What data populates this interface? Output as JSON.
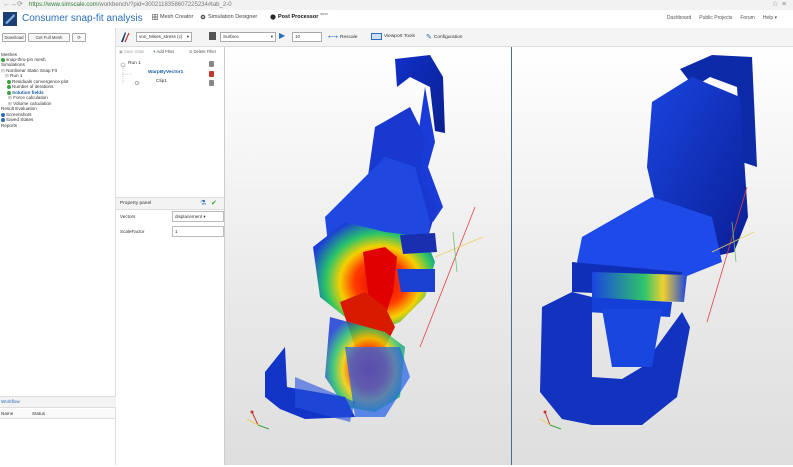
{
  "browser": {
    "url_domain": "https://www.simscale.com",
    "url_rest": "/workbench/?pid=3002118358607225234#tab_2-0"
  },
  "header": {
    "title": "Consumer snap-fit analysis",
    "tabs": [
      {
        "label": "Mesh Creator",
        "icon": "mesh-icon"
      },
      {
        "label": "Simulation Designer",
        "icon": "gears-icon"
      },
      {
        "label": "Post Processor",
        "icon": "circle-icon",
        "badge": "BETA"
      }
    ],
    "links": [
      "Dashboard",
      "Public Projects",
      "Forum",
      "Help ▾"
    ]
  },
  "left_panel": {
    "buttons": [
      "Download",
      "Get Full Mesh"
    ],
    "tree": [
      "Meshes",
      "snap-thru-pin mesh",
      "Simulations",
      "Nonlinear Static Snap Fit",
      "Run 1",
      "Residuals convergence plot",
      "Number of iterations",
      "Solution fields",
      "Force calculation",
      "Volume calculation",
      "Result Evaluation",
      "Screenshots",
      "Saved States",
      "Reports"
    ],
    "workflow_title": "Workflow",
    "workflow_columns": [
      "Name",
      "Status"
    ]
  },
  "mid_panel": {
    "buttons": [
      "Save State",
      "Add Filter",
      "Delete Filter"
    ],
    "tree": [
      "Run 1",
      "WarpByVector1",
      "Clip1"
    ],
    "property_title": "Property panel",
    "property_rows": [
      {
        "label": "Vectors",
        "value": "displacement ▾"
      },
      {
        "label": "ScaleFactor",
        "value": "1"
      }
    ]
  },
  "toolbar": {
    "field_select": "von_Mises_stress (c)",
    "repr_select": "Surface",
    "frame_value": "10",
    "buttons": [
      "Rescale",
      "Viewport Tools",
      "Configuration"
    ]
  },
  "colors": {
    "accent": "#2a6ebb",
    "green_status": "#3ba33b",
    "viewport_divider": "#4a6b8a"
  }
}
